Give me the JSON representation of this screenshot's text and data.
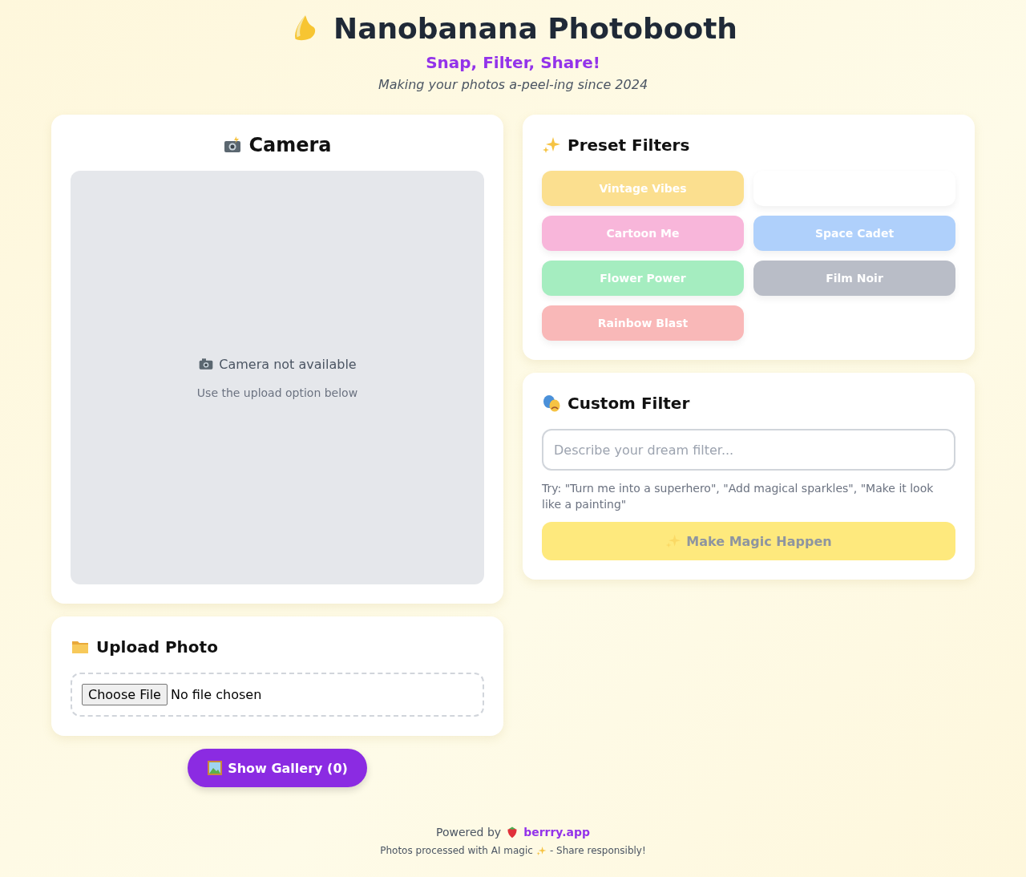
{
  "header": {
    "title": "Nanobanana Photobooth",
    "subtitle": "Snap, Filter, Share!",
    "tagline": "Making your photos a-peel-ing since 2024"
  },
  "camera": {
    "title": "Camera",
    "message": "Camera not available",
    "hint": "Use the upload option below"
  },
  "upload": {
    "title": "Upload Photo",
    "button": "Choose File",
    "status": "No file chosen"
  },
  "gallery_button": "Show Gallery (0)",
  "preset_filters": {
    "title": "Preset Filters",
    "filters": [
      {
        "label": "Vintage Vibes",
        "color": "#fbdf8f"
      },
      {
        "color": "#ffffff"
      },
      {
        "label": "Cartoon Me",
        "color": "#f8b6da"
      },
      {
        "label": "Space Cadet",
        "color": "#afd0fb"
      },
      {
        "label": "Flower Power",
        "color": "#a5edc0"
      },
      {
        "label": "Film Noir",
        "color": "#b9bdc7"
      },
      {
        "label": "Rainbow Blast",
        "color": "#f9b8b8"
      }
    ]
  },
  "custom_filter": {
    "title": "Custom Filter",
    "placeholder": "Describe your dream filter...",
    "hint": "Try: \"Turn me into a superhero\", \"Add magical sparkles\", \"Make it look like a painting\"",
    "button": "Make Magic Happen",
    "disabled": true
  },
  "footer": {
    "powered_by": "Powered by",
    "link": "berrry.app",
    "note_start": "Photos processed with AI magic",
    "note_end": "- Share responsibly!"
  }
}
